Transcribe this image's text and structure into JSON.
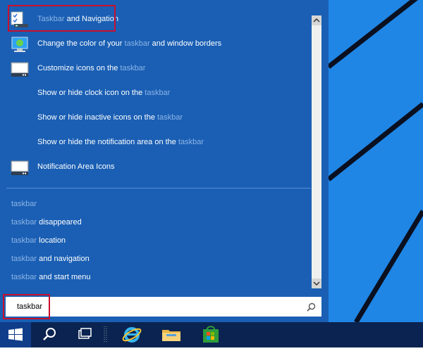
{
  "search": {
    "results": [
      {
        "hl": "Taskbar",
        "rest": " and Navigation",
        "icon": "taskbar-navigation-icon"
      },
      {
        "pre": "Change the color of your ",
        "hl": "taskbar",
        "post": " and window borders",
        "icon": "color-settings-icon"
      },
      {
        "pre": "Customize icons on the ",
        "hl": "taskbar",
        "icon": "notification-area-icon"
      },
      {
        "pre": "Show or hide clock icon on the ",
        "hl": "taskbar"
      },
      {
        "pre": "Show or hide inactive icons on the ",
        "hl": "taskbar"
      },
      {
        "pre": "Show or hide the notification area on the ",
        "hl": "taskbar"
      },
      {
        "pre": "Notification Area Icons",
        "icon": "notification-area-icon"
      }
    ],
    "suggestions": [
      {
        "hl": "taskbar",
        "rest": ""
      },
      {
        "hl": "taskbar",
        "rest": " disappeared"
      },
      {
        "hl": "taskbar",
        "rest": " location"
      },
      {
        "hl": "taskbar",
        "rest": " and navigation"
      },
      {
        "hl": "taskbar",
        "rest": " and start menu"
      }
    ],
    "query": "taskbar",
    "search_icon": "magnifier-icon"
  },
  "taskbar": {
    "items": [
      "windows-start-icon",
      "search-icon",
      "task-view-icon",
      "internet-explorer-icon",
      "file-explorer-icon",
      "store-icon"
    ]
  },
  "colors": {
    "accent": "#1a5fb4",
    "desktop": "#1f86e6",
    "highlight_box": "#c8102e"
  }
}
